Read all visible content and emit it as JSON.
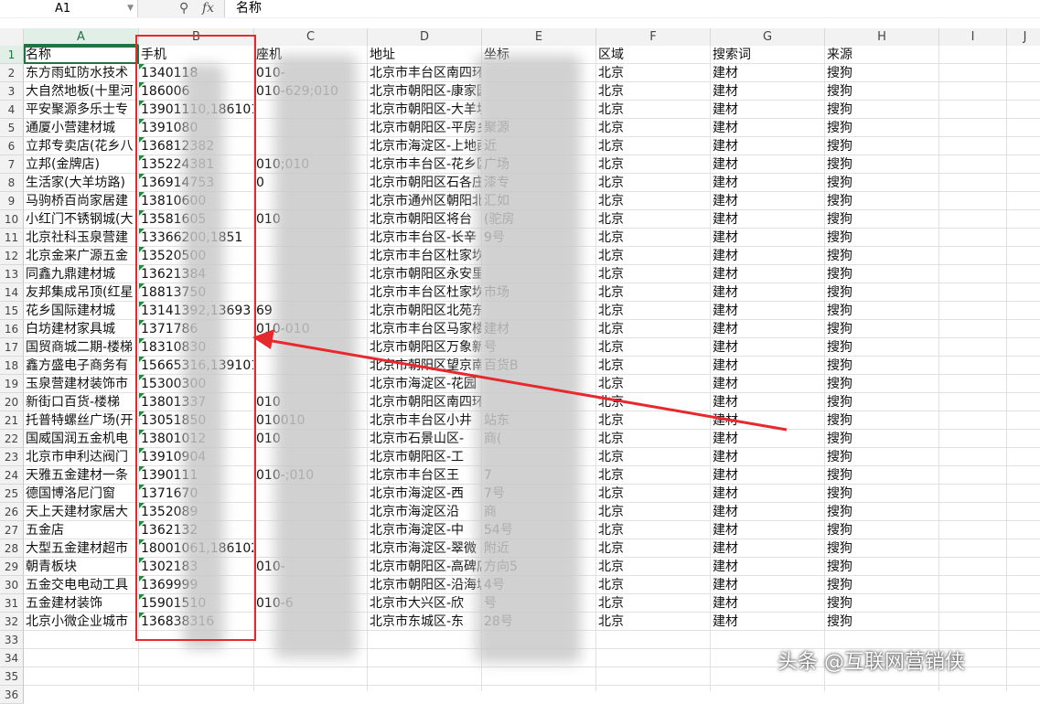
{
  "namebox": {
    "value": "A1"
  },
  "formula": {
    "fx_icon": "fx",
    "content": "名称"
  },
  "columns": [
    "A",
    "B",
    "C",
    "D",
    "E",
    "F",
    "G",
    "H",
    "I",
    "J"
  ],
  "header_row": [
    "名称",
    "手机",
    "座机",
    "地址",
    "坐标",
    "区域",
    "搜索词",
    "来源"
  ],
  "rows": [
    [
      "东方雨虹防水技术",
      "1340118",
      "010-",
      "北京市丰台区南四环西路78号万兴国际",
      "",
      "北京",
      "建材",
      "搜狗"
    ],
    [
      "大自然地板(十里河",
      "186006",
      "010-629;010",
      "北京市朝阳区-康家园",
      "",
      "北京",
      "建材",
      "搜狗"
    ],
    [
      "平安聚源多乐士专",
      "13901110,1861010",
      "",
      "北京市朝阳区-大羊坊之家",
      "",
      "北京",
      "建材",
      "搜狗"
    ],
    [
      "通厦小营建材城",
      "1391080",
      "",
      "北京市朝阳区-平房乡",
      "聚源",
      "北京",
      "建材",
      "搜狗"
    ],
    [
      "立邦专卖店(花乡八",
      "136812382",
      "",
      "北京市海淀区-上地西",
      "近",
      "北京",
      "建材",
      "搜狗"
    ],
    [
      "立邦(金牌店)",
      "135224381",
      "010;010",
      "北京市丰台区-花乡区",
      "广场",
      "北京",
      "建材",
      "搜狗"
    ],
    [
      "生活家(大羊坊路)",
      "136914753",
      "0",
      "北京市朝阳区石各庄",
      "漆专",
      "北京",
      "建材",
      "搜狗"
    ],
    [
      "马驹桥百尚家居建",
      "13810600",
      "",
      "北京市通州区朝阳北",
      "汇如",
      "北京",
      "建材",
      "搜狗"
    ],
    [
      "小红门不锈钢城(大",
      "13581605",
      "010",
      "北京市朝阳区将台",
      "(驼房",
      "北京",
      "建材",
      "搜狗"
    ],
    [
      "北京社科玉泉营建",
      "13366200,1851",
      "",
      "北京市丰台区-长辛",
      "9号",
      "北京",
      "建材",
      "搜狗"
    ],
    [
      "北京金来广源五金",
      "13520500",
      "",
      "北京市丰台区杜家坎",
      "",
      "北京",
      "建材",
      "搜狗"
    ],
    [
      "同鑫九鼎建材城",
      "13621384",
      "",
      "北京市朝阳区永安里",
      "",
      "北京",
      "建材",
      "搜狗"
    ],
    [
      "友邦集成吊顶(红星",
      "18813750",
      "",
      "北京市丰台区杜家坎",
      "市场",
      "北京",
      "建材",
      "搜狗"
    ],
    [
      "花乡国际建材城",
      "13141392,13693",
      "69",
      "北京市朝阳区北苑东",
      "",
      "北京",
      "建材",
      "搜狗"
    ],
    [
      "白坊建材家具城",
      "1371786",
      "010-010",
      "北京市丰台区马家楼",
      "建材",
      "北京",
      "建材",
      "搜狗"
    ],
    [
      "国贸商城二期-楼梯",
      "18310830",
      "",
      "北京市朝阳区万象新",
      "号",
      "北京",
      "建材",
      "搜狗"
    ],
    [
      "鑫方盛电子商务有",
      "15665316,1391013",
      "",
      "北京市朝阳区望京南",
      "百货B",
      "北京",
      "建材",
      "搜狗"
    ],
    [
      "玉泉营建材装饰市",
      "15300300",
      "",
      "北京市海淀区-花园",
      "",
      "北京",
      "建材",
      "搜狗"
    ],
    [
      "新街口百货-楼梯",
      "13801337",
      "010",
      "北京市朝阳区南四环东路",
      "",
      "北京",
      "建材",
      "搜狗"
    ],
    [
      "托普特螺丝广场(开",
      "13051850",
      "010010",
      "北京市丰台区小井",
      "站东",
      "北京",
      "建材",
      "搜狗"
    ],
    [
      "国威国润五金机电",
      "13801012",
      "010",
      "北京市石景山区-",
      "商(",
      "北京",
      "建材",
      "搜狗"
    ],
    [
      "北京市申利达阀门",
      "13910904",
      "",
      "北京市朝阳区-工",
      "",
      "北京",
      "建材",
      "搜狗"
    ],
    [
      "天雅五金建材一条",
      "1390111",
      "010-;010",
      "北京市丰台区王",
      "7",
      "北京",
      "建材",
      "搜狗"
    ],
    [
      "德国博洛尼门窗",
      "1371670",
      "",
      "北京市海淀区-西",
      "7号",
      "北京",
      "建材",
      "搜狗"
    ],
    [
      "天上天建材家居大",
      "1352089",
      "",
      "北京市海淀区沿",
      "商",
      "北京",
      "建材",
      "搜狗"
    ],
    [
      "五金店",
      "1362132",
      "",
      "北京市海淀区-中",
      "54号",
      "北京",
      "建材",
      "搜狗"
    ],
    [
      "大型五金建材超市",
      "18001061,18610204",
      "",
      "北京市海淀区-翠微",
      "附近",
      "北京",
      "建材",
      "搜狗"
    ],
    [
      "朝青板块",
      "1302183",
      "010-",
      "北京市朝阳区-高碑店18",
      "方向5",
      "北京",
      "建材",
      "搜狗"
    ],
    [
      "五金交电电动工具",
      "1369999",
      "",
      "北京市朝阳区-沿海城",
      "4号",
      "北京",
      "建材",
      "搜狗"
    ],
    [
      "五金建材装饰",
      "15901510",
      "010-6",
      "北京市大兴区-欣",
      "号",
      "北京",
      "建材",
      "搜狗"
    ],
    [
      "北京小微企业城市",
      "136838316",
      "",
      "北京市东城区-东",
      "28号",
      "北京",
      "建材",
      "搜狗"
    ]
  ],
  "row_numbers": [
    "1",
    "2",
    "3",
    "4",
    "5",
    "6",
    "7",
    "8",
    "9",
    "10",
    "11",
    "12",
    "13",
    "14",
    "15",
    "16",
    "17",
    "18",
    "19",
    "20",
    "21",
    "22",
    "23",
    "24",
    "25",
    "26",
    "27",
    "28",
    "29",
    "30",
    "31",
    "32",
    "33",
    "34",
    "35",
    "36"
  ],
  "watermark": "头条 @互联网营销侠",
  "colors": {
    "selection": "#217346",
    "annotation": "#e8282d",
    "marker": "#1e8a3e"
  }
}
